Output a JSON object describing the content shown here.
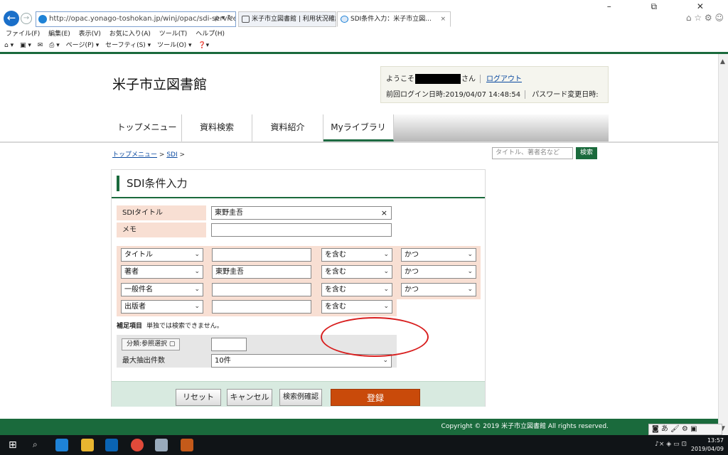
{
  "browser": {
    "url": "http://opac.yonago-toshokan.jp/winj/opac/sdi-service.do",
    "addr_tools": "ρ ▾ ↻",
    "tabs": [
      {
        "label": "米子市立図書館 | 利用状況確認"
      },
      {
        "label": "SDI条件入力：米子市立図...",
        "close": "×"
      }
    ],
    "window_controls": "– ⧉ ✕",
    "right_icons": "⌂ ☆ ⚙ ☺",
    "menu": [
      "ファイル(F)",
      "編集(E)",
      "表示(V)",
      "お気に入り(A)",
      "ツール(T)",
      "ヘルプ(H)"
    ],
    "commands": [
      "⌂ ▾",
      "▣ ▾",
      "✉",
      "⎙ ▾",
      "ページ(P) ▾",
      "セーフティ(S) ▾",
      "ツール(O) ▾",
      "❓▾"
    ]
  },
  "site": {
    "title": "米子市立図書館",
    "welcome_prefix": "ようこそ",
    "welcome_suffix": "さん",
    "logout": "ログアウト",
    "last_login": "前回ログイン日時:2019/04/07 14:48:54",
    "pw_changed": "パスワード変更日時:"
  },
  "nav": {
    "top": "トップメニュー",
    "search": "資料検索",
    "intro": "資料紹介",
    "mylib": "Myライブラリ"
  },
  "breadcrumb": {
    "top": "トップメニュー",
    "sep1": ">",
    "sdi": "SDI",
    "sep2": ">"
  },
  "quick_search": {
    "placeholder": "タイトル、著者名など",
    "button": "検索"
  },
  "form": {
    "title": "SDI条件入力",
    "sdi_title_label": "SDIタイトル",
    "sdi_title_value": "東野圭吾",
    "clear": "×",
    "memo_label": "メモ",
    "memo_value": "",
    "conditions": [
      {
        "field": "タイトル",
        "value": "",
        "match": "を含む",
        "logic": "かつ"
      },
      {
        "field": "著者",
        "value": "東野圭吾",
        "match": "を含む",
        "logic": "かつ"
      },
      {
        "field": "一般件名",
        "value": "",
        "match": "を含む",
        "logic": "かつ"
      },
      {
        "field": "出版者",
        "value": "",
        "match": "を含む"
      }
    ],
    "note_label": "補足項目",
    "note_text": "単独では検索できません。",
    "ref_button": "分類:参照選択 ▢",
    "ref_value": "",
    "max_label": "最大抽出件数",
    "max_value": "10件",
    "arrow": "⌄",
    "buttons": {
      "reset": "リセット",
      "cancel": "キャンセル",
      "example": "検索例確認",
      "register": "登録"
    }
  },
  "footer": {
    "copyright": "Copyright © 2019 米子市立図書館 All rights reserved."
  },
  "ime": "◙ あ 🖌 ⚙ ▣",
  "taskbar": {
    "start": "⊞",
    "search": "⌕",
    "tray": "♪× ◈ ▭ ⊡",
    "time": "13:57",
    "date": "2019/04/09"
  }
}
